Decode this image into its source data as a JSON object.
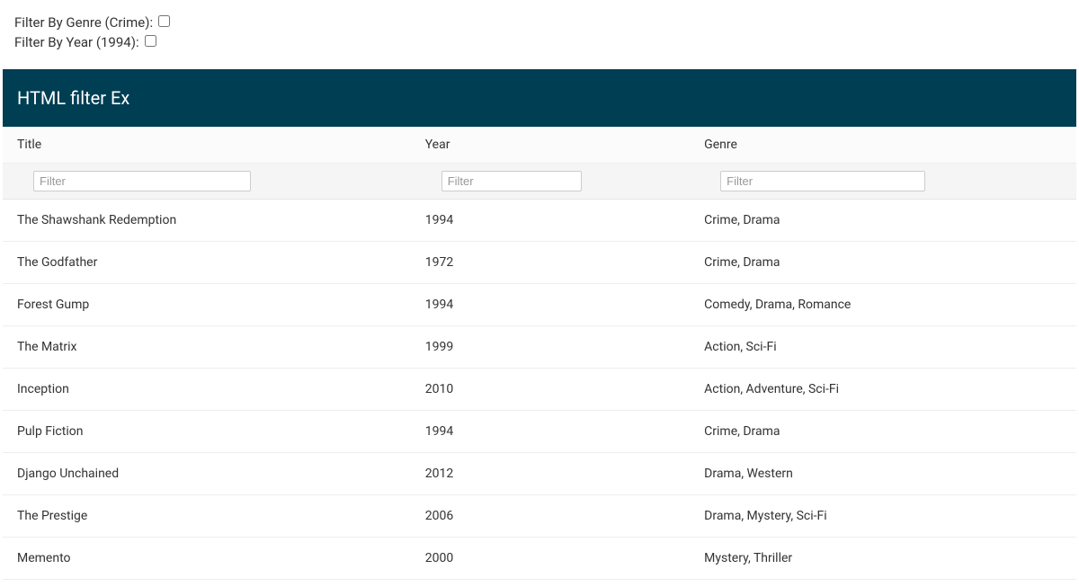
{
  "filters": {
    "genre_label": "Filter By Genre (Crime): ",
    "year_label": "Filter By Year (1994): "
  },
  "panel": {
    "title": "HTML filter Ex"
  },
  "table": {
    "headers": {
      "title": "Title",
      "year": "Year",
      "genre": "Genre"
    },
    "filter_placeholder": "Filter",
    "rows": [
      {
        "title": "The Shawshank Redemption",
        "year": "1994",
        "genre": "Crime, Drama"
      },
      {
        "title": "The Godfather",
        "year": "1972",
        "genre": "Crime, Drama"
      },
      {
        "title": "Forest Gump",
        "year": "1994",
        "genre": "Comedy, Drama, Romance"
      },
      {
        "title": "The Matrix",
        "year": "1999",
        "genre": "Action, Sci-Fi"
      },
      {
        "title": "Inception",
        "year": "2010",
        "genre": "Action, Adventure, Sci-Fi"
      },
      {
        "title": "Pulp Fiction",
        "year": "1994",
        "genre": "Crime, Drama"
      },
      {
        "title": "Django Unchained",
        "year": "2012",
        "genre": "Drama, Western"
      },
      {
        "title": "The Prestige",
        "year": "2006",
        "genre": "Drama, Mystery, Sci-Fi"
      },
      {
        "title": "Memento",
        "year": "2000",
        "genre": "Mystery, Thriller"
      }
    ]
  }
}
